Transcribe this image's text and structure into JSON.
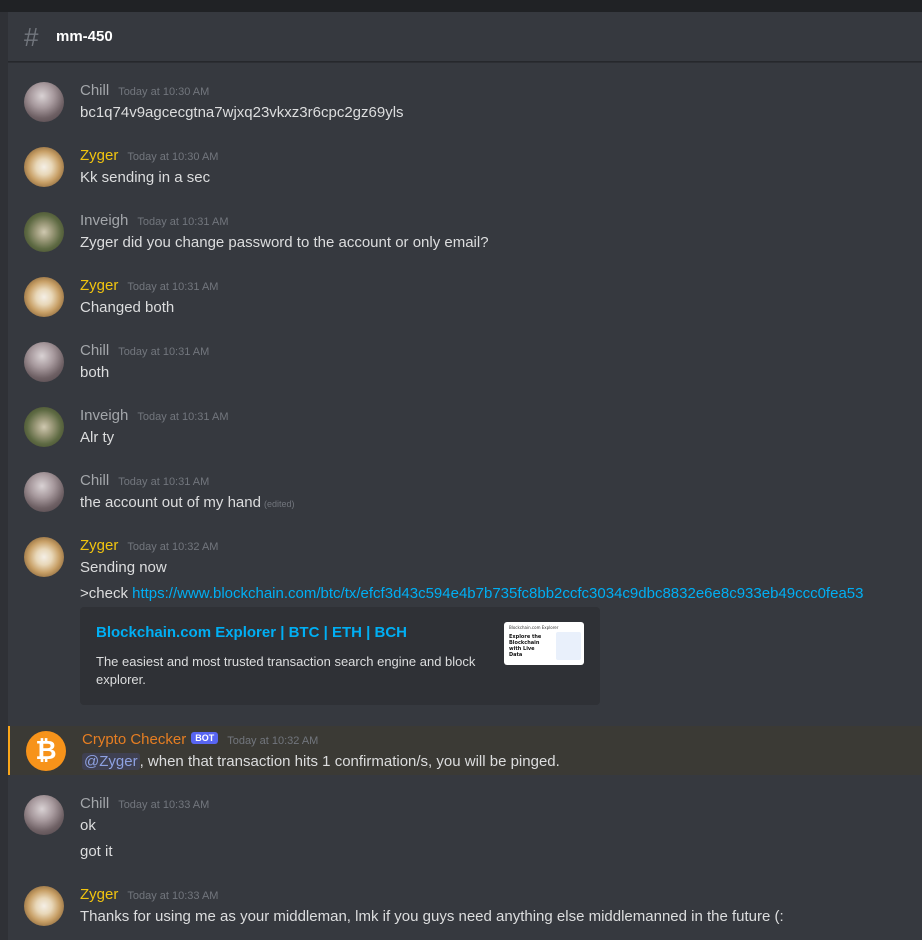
{
  "channel": {
    "name": "mm-450"
  },
  "messages": [
    {
      "author": "Chill",
      "timestamp": "Today at 10:30 AM",
      "lines": [
        "bc1q74v9agcecgtna7wjxq23vkxz3r6cpc2gz69yls"
      ]
    },
    {
      "author": "Zyger",
      "timestamp": "Today at 10:30 AM",
      "lines": [
        "Kk sending in a sec"
      ]
    },
    {
      "author": "Inveigh",
      "timestamp": "Today at 10:31 AM",
      "lines": [
        "Zyger did you change password to the account or only email?"
      ]
    },
    {
      "author": "Zyger",
      "timestamp": "Today at 10:31 AM",
      "lines": [
        "Changed both"
      ]
    },
    {
      "author": "Chill",
      "timestamp": "Today at 10:31 AM",
      "lines": [
        "both"
      ]
    },
    {
      "author": "Inveigh",
      "timestamp": "Today at 10:31 AM",
      "lines": [
        "Alr ty"
      ]
    },
    {
      "author": "Chill",
      "timestamp": "Today at 10:31 AM",
      "lines": [
        "the account out of my hand"
      ],
      "edited": "(edited)"
    },
    {
      "author": "Zyger",
      "timestamp": "Today at 10:32 AM",
      "lines": [
        "Sending now"
      ],
      "check_prefix": ">check ",
      "link": "https://www.blockchain.com/btc/tx/efcf3d43c594e4b7b735fc8bb2ccfc3034c9dbc8832e6e8c933eb49ccc0fea53",
      "embed": {
        "title": "Blockchain.com Explorer | BTC | ETH | BCH",
        "description": "The easiest and most trusted transaction search engine and block explorer.",
        "thumb_brand": "Blockchain.com Explorer",
        "thumb_headline": "Explore the Blockchain with Live Data"
      }
    },
    {
      "author": "Crypto Checker",
      "badge": "BOT",
      "timestamp": "Today at 10:32 AM",
      "mention": "@Zyger",
      "text_after_mention": ", when that transaction hits 1 confirmation/s, you will be pinged."
    },
    {
      "author": "Chill",
      "timestamp": "Today at 10:33 AM",
      "lines": [
        "ok",
        "got it"
      ]
    },
    {
      "author": "Zyger",
      "timestamp": "Today at 10:33 AM",
      "lines": [
        "Thanks for using me as your middleman, lmk if you guys need anything else middlemanned in the future (:"
      ]
    }
  ],
  "colors": {
    "chill": "#a3a6aa",
    "zyger": "#f1c40f",
    "inveigh": "#a3a6aa",
    "bot": "#e67e22",
    "bitcoin": "#f7931a",
    "link": "#00aff4",
    "highlight_border": "#faa61a"
  }
}
